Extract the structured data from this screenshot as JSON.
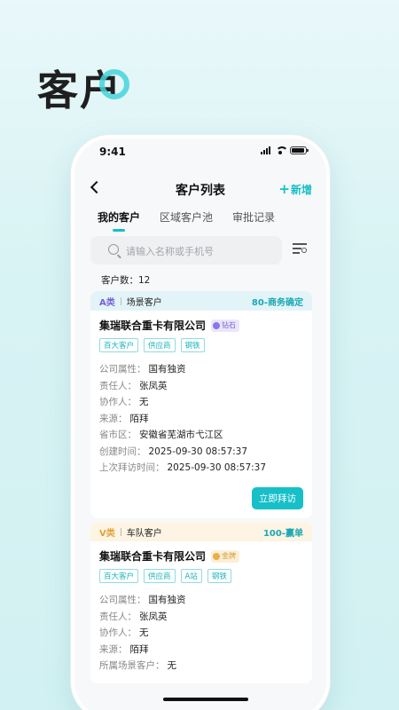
{
  "promo": {
    "title": "客户"
  },
  "status_bar": {
    "time": "9:41"
  },
  "nav": {
    "back": "back",
    "title": "客户列表",
    "add_plus": "+",
    "add_label": "新增"
  },
  "tabs": [
    {
      "label": "我的客户",
      "active": true
    },
    {
      "label": "区域客户池",
      "active": false
    },
    {
      "label": "审批记录",
      "active": false
    }
  ],
  "search": {
    "placeholder": "请输入名称或手机号"
  },
  "count": {
    "label": "客户数：",
    "value": "12"
  },
  "cards": [
    {
      "class_label": "A类",
      "scene": "场景客户",
      "stage": "80-商务确定",
      "company": "集瑞联合重卡有限公司",
      "badge": "钻石",
      "tags": [
        "百大客户",
        "供应商",
        "钢铁"
      ],
      "fields": [
        {
          "label": "公司属性：",
          "value": "国有独资"
        },
        {
          "label": "责任人：",
          "value": "张凤英"
        },
        {
          "label": "协作人：",
          "value": "无"
        },
        {
          "label": "来源：",
          "value": "陌拜"
        },
        {
          "label": "省市区：",
          "value": "安徽省芜湖市弋江区"
        },
        {
          "label": "创建时间：",
          "value": "2025-09-30 08:57:37"
        },
        {
          "label": "上次拜访时间：",
          "value": "2025-09-30 08:57:37"
        }
      ],
      "action": "立即拜访"
    },
    {
      "class_label": "V类",
      "scene": "车队客户",
      "stage": "100-赢单",
      "company": "集瑞联合重卡有限公司",
      "badge": "金牌",
      "tags": [
        "百大客户",
        "供应商",
        "A站",
        "钢铁"
      ],
      "fields": [
        {
          "label": "公司属性：",
          "value": "国有独资"
        },
        {
          "label": "责任人：",
          "value": "张凤英"
        },
        {
          "label": "协作人：",
          "value": "无"
        },
        {
          "label": "来源：",
          "value": "陌拜"
        },
        {
          "label": "所属场景客户：",
          "value": "无"
        }
      ]
    }
  ],
  "colors": {
    "accent": "#17bfc9",
    "a_class": "#7760d6",
    "v_class": "#e0a23a"
  }
}
